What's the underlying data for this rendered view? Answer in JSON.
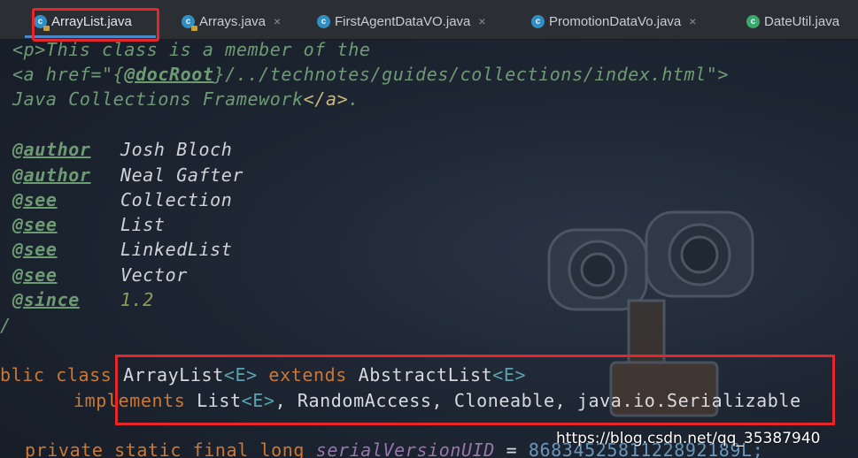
{
  "tabs": [
    {
      "label": "ArrayList.java",
      "icon": "class-locked-icon",
      "active": true
    },
    {
      "label": "Arrays.java",
      "icon": "class-locked-icon",
      "active": false
    },
    {
      "label": "FirstAgentDataVO.java",
      "icon": "class-icon",
      "active": false
    },
    {
      "label": "PromotionDataVo.java",
      "icon": "class-icon",
      "active": false
    },
    {
      "label": "DateUtil.java",
      "icon": "class-icon",
      "active": false
    }
  ],
  "tab_close_glyph": "×",
  "doc": {
    "line1": "<p>This class is a member of the",
    "line2_a": "<a href=\"{",
    "line2_b": "@docRoot",
    "line2_c": "}/../technotes/guides/collections/index.html\">",
    "line3_a": "Java Collections Framework",
    "line3_b": "</a>",
    "line3_c": ".",
    "tags": [
      {
        "tag": "@author",
        "value": "Josh Bloch"
      },
      {
        "tag": "@author",
        "value": "Neal Gafter"
      },
      {
        "tag": "@see",
        "value": "Collection"
      },
      {
        "tag": "@see",
        "value": "List"
      },
      {
        "tag": "@see",
        "value": "LinkedList"
      },
      {
        "tag": "@see",
        "value": "Vector"
      },
      {
        "tag": "@since",
        "value": "1.2"
      }
    ],
    "end": "/"
  },
  "code": {
    "class_decl": {
      "kw1": "blic class ",
      "name": "ArrayList",
      "gen1": "<E>",
      "kw2": " extends ",
      "parent": "AbstractList",
      "gen2": "<E>"
    },
    "implements_line": {
      "kw": "implements ",
      "i1": "List",
      "gen": "<E>",
      "rest": ", RandomAccess, Cloneable, java.io.Serializable"
    },
    "field_line": {
      "kw": "private static final long ",
      "name": "serialVersionUID",
      "eq": " = ",
      "value": "8683452581122892189L;"
    }
  },
  "watermark": "https://blog.csdn.net/qq_35387940",
  "colors": {
    "highlight_red": "#e5262a",
    "tab_underline": "#4a88c7"
  }
}
